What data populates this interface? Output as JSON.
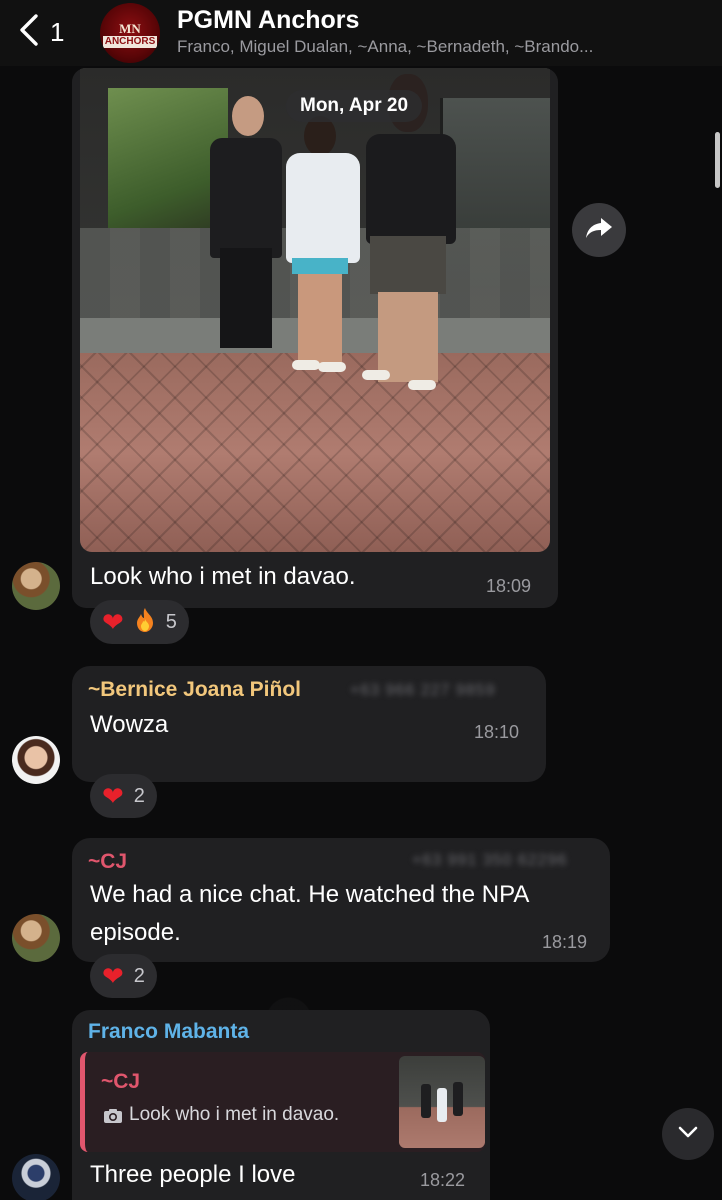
{
  "header": {
    "back_count": "1",
    "group_title": "PGMN Anchors",
    "group_members": "Franco, Miguel Dualan, ~Anna, ~Bernadeth, ~Brando...",
    "avatar_line1": "MN",
    "avatar_line2": "ANCHORS"
  },
  "date_pill": "Mon, Apr 20",
  "messages": [
    {
      "type": "photo",
      "caption": "Look who i met in davao.",
      "time": "18:09",
      "reactions": {
        "count": "5"
      }
    },
    {
      "sender": "~Bernice Joana Piñol",
      "sender_color": "#f2c77c",
      "phone": "+63 966 227 9859",
      "text": "Wowza",
      "time": "18:10",
      "reactions": {
        "count": "2"
      }
    },
    {
      "sender": "~CJ",
      "sender_color": "#e0566d",
      "phone": "+63 991 350 62296",
      "text": "We had a nice chat. He watched the NPA episode.",
      "text_line1": "We had a nice chat. He watched the NPA",
      "text_line2": "episode.",
      "time": "18:19",
      "reactions": {
        "count": "2"
      }
    },
    {
      "sender": "Franco Mabanta",
      "sender_color": "#5fb3e8",
      "reply": {
        "sender": "~CJ",
        "text": "Look who i met in davao."
      },
      "text": "Three people I love",
      "time": "18:22"
    }
  ],
  "icons": {
    "back": "chevron-left-icon",
    "forward": "forward-share-icon",
    "camera": "camera-icon",
    "scroll_down": "chevron-down-icon",
    "heart": "❤",
    "fire": "fire-icon"
  }
}
